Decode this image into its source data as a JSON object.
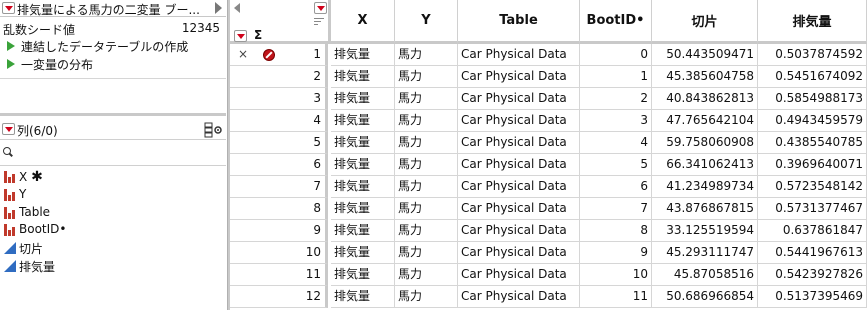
{
  "table_panel": {
    "title": "排気量による馬力の二変量 ブー...",
    "properties": [
      {
        "label": "乱数シード値",
        "value": "12345"
      }
    ],
    "scripts": [
      "連結したデータテーブルの作成",
      "一変量の分布"
    ]
  },
  "columns_panel": {
    "title": "列(6/0)",
    "search_placeholder": "",
    "items": [
      {
        "label": "X",
        "suffix": "✱",
        "type": "nominal"
      },
      {
        "label": "Y",
        "suffix": "",
        "type": "nominal"
      },
      {
        "label": "Table",
        "suffix": "",
        "type": "nominal"
      },
      {
        "label": "BootID•",
        "suffix": "",
        "type": "nominal"
      },
      {
        "label": "切片",
        "suffix": "",
        "type": "continuous"
      },
      {
        "label": "排気量",
        "suffix": "",
        "type": "continuous"
      }
    ]
  },
  "grid": {
    "sigma": "Σ",
    "headers": [
      "X",
      "Y",
      "Table",
      "BootID•",
      "切片",
      "排気量"
    ],
    "rows": [
      {
        "n": "1",
        "x": "排気量",
        "y": "馬力",
        "table": "Car Physical Data",
        "boot": "0",
        "intercept": "50.443509471",
        "disp": "0.5037874592",
        "marked": true
      },
      {
        "n": "2",
        "x": "排気量",
        "y": "馬力",
        "table": "Car Physical Data",
        "boot": "1",
        "intercept": "45.385604758",
        "disp": "0.5451674092"
      },
      {
        "n": "3",
        "x": "排気量",
        "y": "馬力",
        "table": "Car Physical Data",
        "boot": "2",
        "intercept": "40.843862813",
        "disp": "0.5854988173"
      },
      {
        "n": "4",
        "x": "排気量",
        "y": "馬力",
        "table": "Car Physical Data",
        "boot": "3",
        "intercept": "47.765642104",
        "disp": "0.4943459579"
      },
      {
        "n": "5",
        "x": "排気量",
        "y": "馬力",
        "table": "Car Physical Data",
        "boot": "4",
        "intercept": "59.758060908",
        "disp": "0.4385540785"
      },
      {
        "n": "6",
        "x": "排気量",
        "y": "馬力",
        "table": "Car Physical Data",
        "boot": "5",
        "intercept": "66.341062413",
        "disp": "0.3969640071"
      },
      {
        "n": "7",
        "x": "排気量",
        "y": "馬力",
        "table": "Car Physical Data",
        "boot": "6",
        "intercept": "41.234989734",
        "disp": "0.5723548142"
      },
      {
        "n": "8",
        "x": "排気量",
        "y": "馬力",
        "table": "Car Physical Data",
        "boot": "7",
        "intercept": "43.876867815",
        "disp": "0.5731377467"
      },
      {
        "n": "9",
        "x": "排気量",
        "y": "馬力",
        "table": "Car Physical Data",
        "boot": "8",
        "intercept": "33.125519594",
        "disp": "0.637861847"
      },
      {
        "n": "10",
        "x": "排気量",
        "y": "馬力",
        "table": "Car Physical Data",
        "boot": "9",
        "intercept": "45.293111747",
        "disp": "0.5441967613"
      },
      {
        "n": "11",
        "x": "排気量",
        "y": "馬力",
        "table": "Car Physical Data",
        "boot": "10",
        "intercept": "45.87058516",
        "disp": "0.5423927826"
      },
      {
        "n": "12",
        "x": "排気量",
        "y": "馬力",
        "table": "Car Physical Data",
        "boot": "11",
        "intercept": "50.686966854",
        "disp": "0.5137395469"
      }
    ]
  },
  "colors": {
    "accent_red": "#d0021b",
    "nominal_icon": "#c0392b",
    "continuous_icon": "#2f6cc1",
    "script_play": "#3aa33a"
  }
}
